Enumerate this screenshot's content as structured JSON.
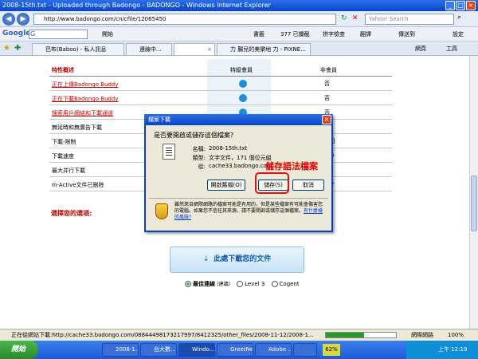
{
  "window": {
    "title": "2008-15th.txt - Uploaded through Badongo - BADONGO - Windows Internet Explorer"
  },
  "address": {
    "url": "http://www.badongo.com/cn/cfile/12065450",
    "search_placeholder": "Yahoo! Search"
  },
  "google_bar": {
    "logo": "Google",
    "g_label": "G",
    "items": [
      "開始",
      "書籤",
      "377 已攔截",
      "拼字檢查",
      "翻譯",
      "傳送到",
      "設定"
    ]
  },
  "tabs": {
    "items": [
      "巴布(Baboo) - 私人訊息",
      "連線中...",
      "",
      "力 腸兒的美樂地 力 - PIXNE..."
    ],
    "menu": [
      "網頁",
      "工具"
    ]
  },
  "page": {
    "headers": {
      "feature": "特性概述",
      "premium": "特級會員",
      "free": "非會員"
    },
    "rows": [
      {
        "label": "正在上傳Badongo Buddy",
        "free": "否"
      },
      {
        "label": "正在下載Badongo Buddy",
        "free": "否"
      },
      {
        "label": "搜索用戶網絡和下載通道",
        "free": "否"
      },
      {
        "label": "無延時和無廣告下載",
        "free": ""
      },
      {
        "label": "下載-限制",
        "free": "每日"
      },
      {
        "label": "下載速度",
        "free": "bps"
      },
      {
        "label": "最大并行下載",
        "free": ""
      },
      {
        "label": "In-Active文件已刪除",
        "free": "後 *"
      }
    ],
    "choose": "選擇您的選項:",
    "download_btn": "此處下載您的文件",
    "radios": {
      "best": "最佳連線",
      "rec": "(建議)",
      "l3": "Level 3",
      "cogent": "Cogent"
    }
  },
  "dialog": {
    "title": "檔案下載",
    "question": "是否要開啟或儲存這個檔案?",
    "name_k": "名稱:",
    "name_v": "2008-15th.txt",
    "type_k": "類型:",
    "type_v": "文字文件，171 個位元組",
    "from_k": "從:",
    "from_v": "cache33.badongo.com",
    "open_btn": "開啟舊檔(O)",
    "save_btn": "儲存(S)",
    "cancel_btn": "取消",
    "warning": "雖然來自網際網路的檔案可能是有用的，但是某些檔案有可能會傷害您的電腦。如果您不信任其來源，請不要開啟或儲存這個檔案。",
    "risk_link": "有什麼樣的風險?"
  },
  "annotation": {
    "label": "儲存語法檔案"
  },
  "status": {
    "text": "正在從網站下載:http://cache33.badongo.com/08844498173217997/8412325/other_files/2008-11-12/2008-1...",
    "zone": "網際網路",
    "zoom": "100%",
    "progress": 0.55
  },
  "taskbar": {
    "start": "開始",
    "tasks": [
      "2008-1...",
      "台大數...",
      "Windo...",
      "GreetNe...",
      "Adobe ...",
      ""
    ],
    "battery": "62%",
    "clock": "上午 12:19"
  },
  "colors": {
    "accent": "#0a46c8",
    "annotation_red": "#e00000",
    "link_red": "#c00000"
  }
}
